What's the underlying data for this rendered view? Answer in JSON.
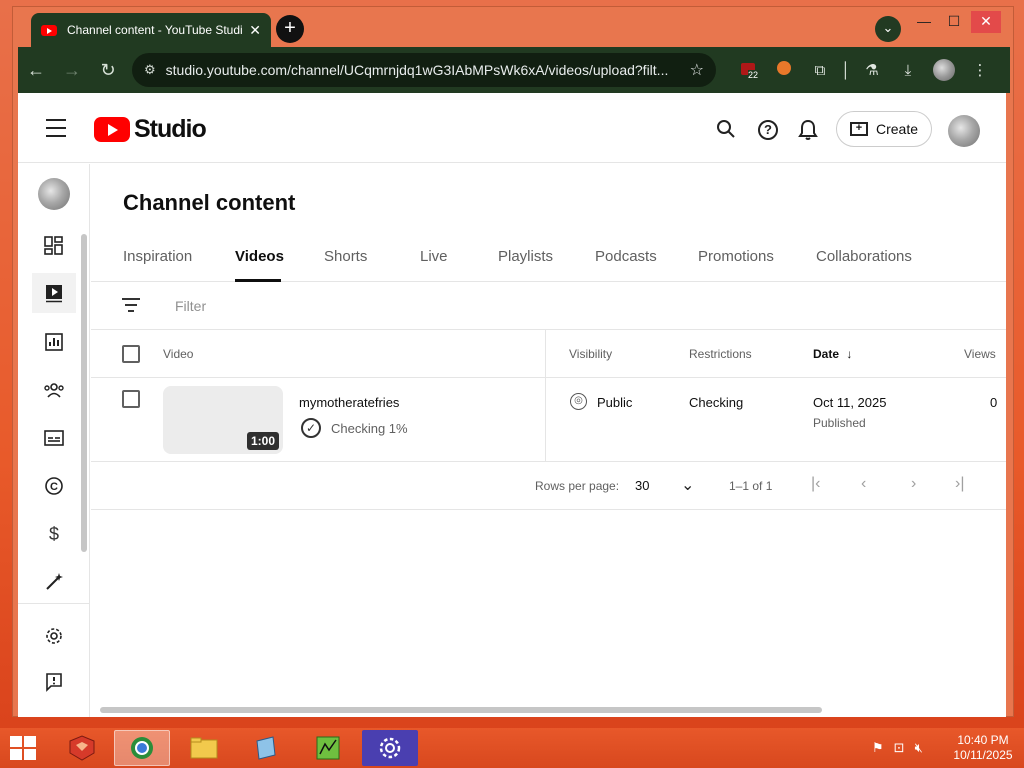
{
  "browser": {
    "tab_title": "Channel content - YouTube Studio",
    "tab_close": "✕",
    "new_tab": "+",
    "url": "studio.youtube.com/channel/UCqmrnjdq1wG3IAbMPsWk6xA/videos/upload?filt...",
    "extension_badge": "22",
    "window_min": "—",
    "window_max": "☐",
    "window_close": "✕"
  },
  "header": {
    "logo_text": "Studio",
    "create_label": "Create"
  },
  "page": {
    "title": "Channel content",
    "tabs": [
      "Inspiration",
      "Videos",
      "Shorts",
      "Live",
      "Playlists",
      "Podcasts",
      "Promotions",
      "Collaborations"
    ],
    "active_tab": "Videos",
    "filter_placeholder": "Filter"
  },
  "table": {
    "columns": {
      "video": "Video",
      "visibility": "Visibility",
      "restrictions": "Restrictions",
      "date": "Date",
      "views": "Views"
    },
    "rows": [
      {
        "title": "mymotheratefries",
        "duration": "1:00",
        "status": "Checking 1%",
        "visibility": "Public",
        "restrictions": "Checking",
        "date": "Oct 11, 2025",
        "date_sub": "Published",
        "views": "0"
      }
    ]
  },
  "pagination": {
    "rows_per_page_label": "Rows per page:",
    "rows_per_page_value": "30",
    "range": "1–1 of 1"
  },
  "taskbar": {
    "time": "10:40 PM",
    "date": "10/11/2025"
  },
  "colors": {
    "brand_red": "#ff0000",
    "browser_frame": "#213a21",
    "desktop": "#e85a2a"
  }
}
